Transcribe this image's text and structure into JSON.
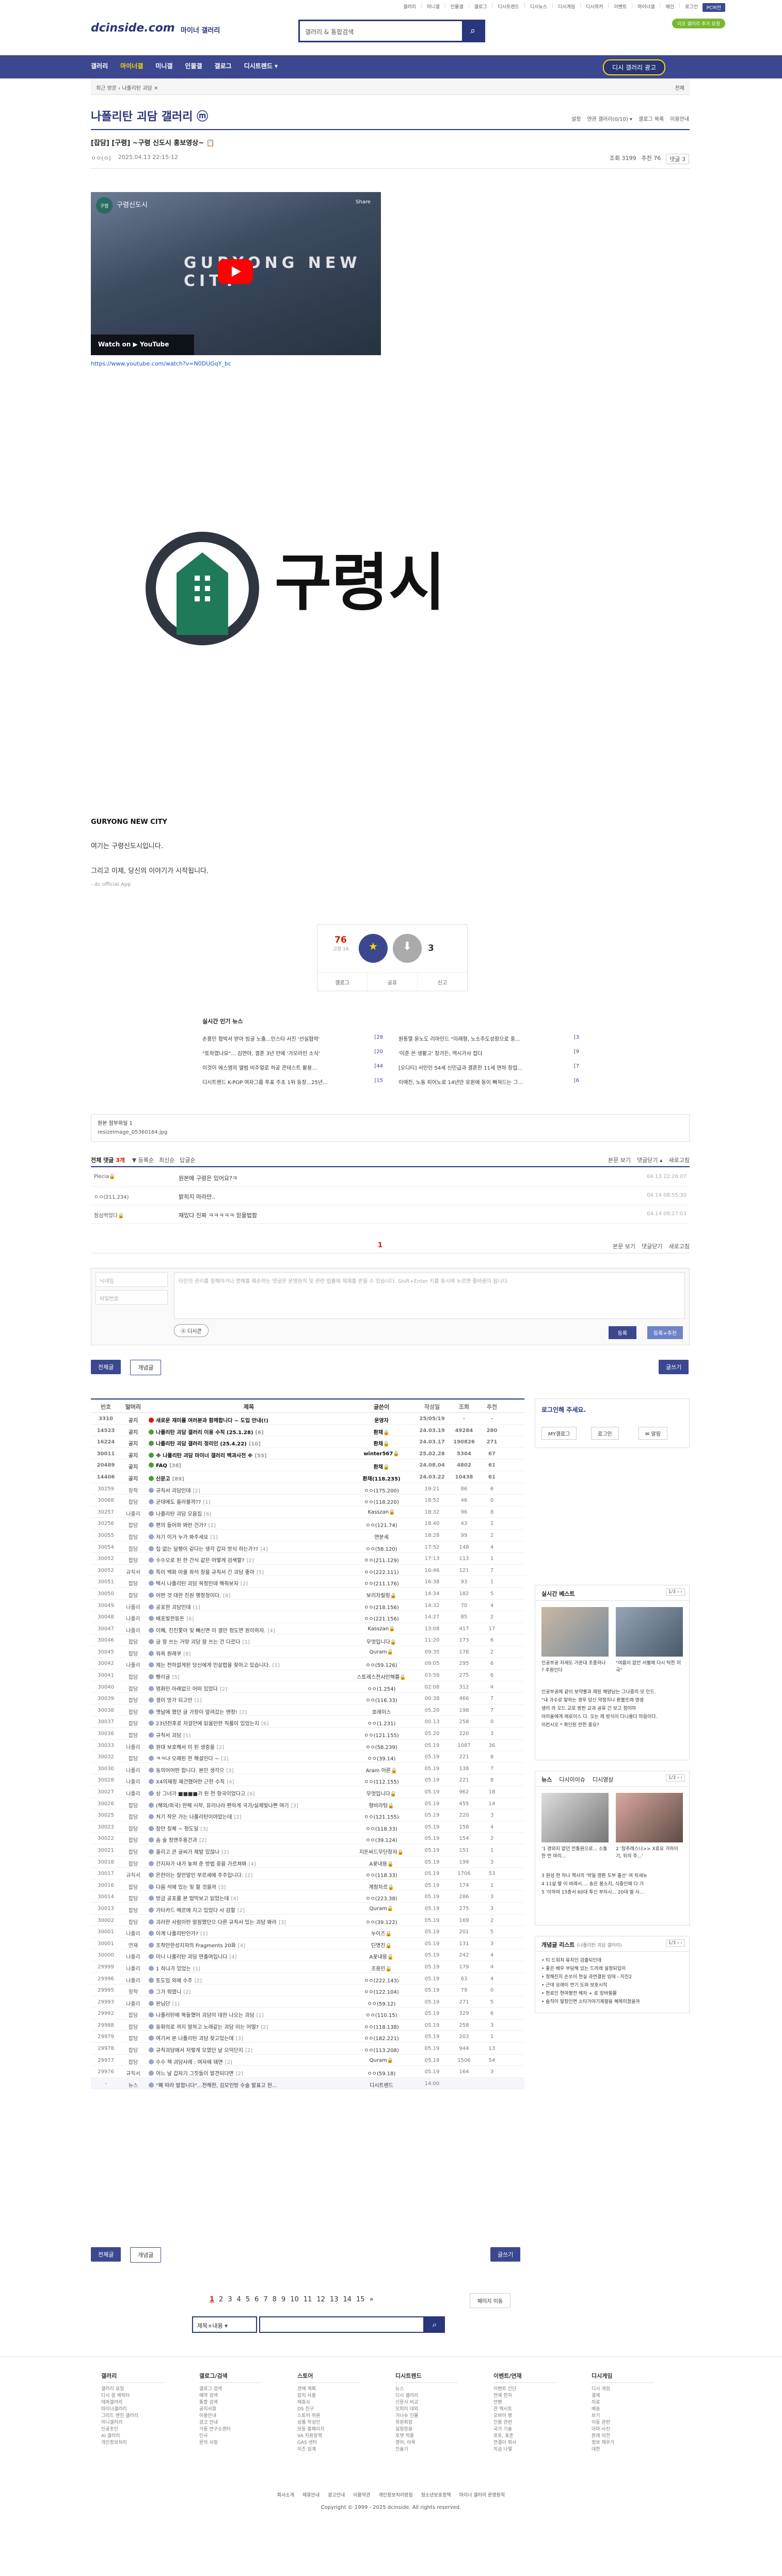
{
  "toplinks": [
    "갤러리",
    "미니갤",
    "인물갤",
    "갤로그",
    "디시트렌드",
    "디시뉴스",
    "디시게임",
    "디시위키",
    "이벤트",
    "마이너갤",
    "메인",
    "로그인"
  ],
  "top_btn": "PC버전",
  "top_green": "이오 갤러리 추가 요청",
  "logo": "dcinside.com",
  "logo_sub": "마이너 갤러리",
  "search_placeholder": "갤러리 & 통합검색",
  "gnb": [
    "갤러리",
    "마이너갤",
    "미니갤",
    "인물갤",
    "갤로그",
    "디시트렌드 ▾"
  ],
  "gnb_btn": "디시 갤러리 광고",
  "crumb_left": "최근 방문   ‹   나폴리탄 괴담 ✕",
  "crumb_right": "전체",
  "gallery_title": "나폴리탄 괴담 갤러리 ⓜ",
  "gallery_tools": [
    "설정",
    "연관 갤러리(0/10) ▾",
    "갤로그 목록",
    "이용안내"
  ],
  "post": {
    "title": "[잡담] [구령] ~구령 신도시 홍보영상~ 📋",
    "author": "ㅇㅇ(ㅇ)",
    "date": "2025.04.13 22:15:12",
    "views": "조회 3199",
    "rec": "추천 76",
    "comments": "댓글 3"
  },
  "video": {
    "channel": "구령신도시",
    "share": "Share",
    "overlay": "GURYONG NEW CITY",
    "watch": "Watch on ▶ YouTube",
    "link": "https://www.youtube.com/watch?v=N0DUGqY_bc"
  },
  "city_name": "구령시",
  "body": {
    "l1": "GURYONG NEW CITY",
    "l2": "여기는 구령신도시입니다.",
    "l3": "그리고 이제, 당신의 이야기가 시작됩니다.",
    "l4": "- dc official App"
  },
  "vote": {
    "up": "76",
    "up_sub": "고정 16",
    "down": "3",
    "acts": [
      "갤로그",
      "공유",
      "신고"
    ]
  },
  "popular": {
    "title": "실시간 인기 뉴스",
    "left": [
      {
        "t": "손흥민 협박서 받아 빙글 노출...인스타 사진 '선실협력'",
        "n": "[28"
      },
      {
        "t": "\"토하였나요\"... 김연아, 결혼 3년 만에 '가모라인 소식'",
        "n": "[20"
      },
      {
        "t": "이것이 에스엠의 앨범 비주얼로 허공 콘테스트 활용...",
        "n": "[44"
      },
      {
        "t": "디시트렌드 K-POP 여자그룹 투표 주초 1위 등장...25년...",
        "n": "[15"
      }
    ],
    "right": [
      {
        "t": "원통열 윤노도 리마인드 \"미래형, 노소주도성장으로 중...",
        "n": "[3"
      },
      {
        "t": "'이준 쓴 생활고' 장가든, 역시가사 잡다",
        "n": "[9"
      },
      {
        "t": "[오디티] 서민인 54세 신민급과 결혼한 11세 연하 창업...",
        "n": "[7"
      },
      {
        "t": "이매진, 노동 피어노로 14년만 유원에 동이 빠져드는 그...",
        "n": "[6"
      }
    ]
  },
  "attach": {
    "label": "원본 첨부파일 1",
    "file": "resizeImage_05360184.jpg"
  },
  "comments": {
    "head_left": "전체 댓글",
    "count": "3개",
    "sort": [
      "▼ 등록순",
      "최신순",
      "답글순"
    ],
    "head_right": [
      "본문 보기",
      "댓글닫기 ▴",
      "새로고침"
    ],
    "rows": [
      {
        "nick": "Plecia🔒",
        "body": "원본에 구령은 있어요?ㅋ",
        "date": "04.13 22:26:07"
      },
      {
        "nick": "ㅇㅇ(211.234)",
        "body": "밝히지 마라만..",
        "date": "04.14 08:55:30"
      },
      {
        "nick": "점심먹었다🔒",
        "body": "재밌다 진짜 ㅋㅋㅋㅋㅋ 믿을법함",
        "date": "04.14 09:27:03"
      }
    ],
    "page": "1",
    "bottom_right": [
      "본문 보기",
      "댓글닫기",
      "새로고침"
    ]
  },
  "write": {
    "nick": "닉네임",
    "pw": "비밀번호",
    "text": "타인의 권리를 침해하거나 명예를 훼손하는 댓글은 운영원칙 및 관련 법률에 제재를 받을 수 있습니다.\nShift+Enter 키를 동시에 누르면 줄바꿈이 됩니다.",
    "dccon": "ⓓ 디시콘",
    "submit": "등록",
    "submit2": "등록+추천"
  },
  "tabs": [
    "전체글",
    "개념글"
  ],
  "write_btn": "글쓰기",
  "list_head": [
    "번호",
    "말머리",
    "제목",
    "글쓴이",
    "작성일",
    "조회",
    "추천"
  ],
  "list_rows": [
    {
      "no": "3310",
      "hd": "공지",
      "t": "새로운 재미를 여러분과 함께합니다 ~ 도입 안내(!)",
      "w": "운영자",
      "d": "25/05/19",
      "v": "-",
      "r": "-",
      "n": true,
      "i": "r"
    },
    {
      "no": "14523",
      "hd": "공지",
      "t": "나폴리탄 괴담 갤러리 이용 수칙 (25.1.28)",
      "cn": "[6]",
      "w": "환채🔒",
      "d": "24.03.19",
      "v": "49284",
      "r": "280",
      "n": true,
      "i": "g"
    },
    {
      "no": "16224",
      "hd": "공지",
      "t": "나폴리탄 괴담 갤러리 정리인 (25.4.22)",
      "cn": "[10]",
      "w": "환채🔒",
      "d": "24.03.17",
      "v": "190826",
      "r": "271",
      "n": true,
      "i": "g"
    },
    {
      "no": "30011",
      "hd": "공지",
      "t": "※ 나폴리탄 괴담 마이너 갤러리 백과사전 ※",
      "cn": "[55]",
      "w": "winter567🔒",
      "d": "25.02.28",
      "v": "5304",
      "r": "67",
      "n": true,
      "i": "g"
    },
    {
      "no": "20489",
      "hd": "공지",
      "t": "FAQ",
      "cn": "[38]",
      "w": "환채🔒",
      "d": "24.08.04",
      "v": "4802",
      "r": "61",
      "n": true,
      "i": "g"
    },
    {
      "no": "14406",
      "hd": "공지",
      "t": "신문고",
      "cn": "[89]",
      "w": "환채(118.235)",
      "d": "24.03.22",
      "v": "10438",
      "r": "61",
      "n": true,
      "i": "g"
    },
    {
      "no": "30259",
      "hd": "창작",
      "t": "규칙서 괴담인데",
      "cn": "[2]",
      "w": "ㅇㅇ(175.200)",
      "d": "19:21",
      "v": "86",
      "r": "6"
    },
    {
      "no": "30068",
      "hd": "잡담",
      "t": "균대에도 올라볼까??",
      "cn": "[1]",
      "w": "ㅇㅇ(118.220)",
      "d": "18:52",
      "v": "46",
      "r": "0"
    },
    {
      "no": "30257",
      "hd": "나폴리",
      "t": "나폴리탄 괴담 모음집",
      "cn": "[6]",
      "w": "Kasszan🔒",
      "d": "18:32",
      "v": "96",
      "r": "8"
    },
    {
      "no": "30256",
      "hd": "잡담",
      "t": "편의 들어와 봐란 건가?",
      "cn": "[2]",
      "w": "ㅇㅇ(121.74)",
      "d": "18:40",
      "v": "43",
      "r": "2"
    },
    {
      "no": "30055",
      "hd": "잡담",
      "t": "저기 이거 누가 봐주세요",
      "cn": "[1]",
      "w": "연분세",
      "d": "18:28",
      "v": "99",
      "r": "2"
    },
    {
      "no": "30054",
      "hd": "잡담",
      "t": "집 없는 달팽이 같다는 생각 갑자 방식 하는가??",
      "cn": "[4]",
      "w": "ㅇㅇ(58.120)",
      "d": "17:52",
      "v": "148",
      "r": "4"
    },
    {
      "no": "30052",
      "hd": "잡담",
      "t": "수수오로 된 한 간식 같은 어떻게 검색할?",
      "cn": "[2]",
      "w": "ㅇㅇ(211.129)",
      "d": "17:13",
      "v": "113",
      "r": "1"
    },
    {
      "no": "30052",
      "hd": "규칙서",
      "t": "특이 백화 아울 좌석 창을 규칙서 긴 괴담 좋아",
      "cn": "[5]",
      "w": "ㅇㅇ(222.111)",
      "d": "16:46",
      "v": "121",
      "r": "7"
    },
    {
      "no": "30051",
      "hd": "잡담",
      "t": "택시 나폴리탄 괴담 목정인데 해줘보자",
      "cn": "[2]",
      "w": "ㅇㅇ(211.176)",
      "d": "16:38",
      "v": "93",
      "r": "1"
    },
    {
      "no": "30050",
      "hd": "잡담",
      "t": "어떤 것 대한 친원 행정청이다.",
      "cn": "[6]",
      "w": "보리차릴링🔒",
      "d": "14:34",
      "v": "182",
      "r": "5"
    },
    {
      "no": "30049",
      "hd": "나폴리",
      "t": "공포한 괴담인데",
      "cn": "[1]",
      "w": "ㅇㅇ(218.156)",
      "d": "14:32",
      "v": "70",
      "r": "4"
    },
    {
      "no": "30048",
      "hd": "나폴리",
      "t": "배포빛한등돈",
      "cn": "[6]",
      "w": "ㅇㅇ(221.156)",
      "d": "14:27",
      "v": "85",
      "r": "2"
    },
    {
      "no": "30047",
      "hd": "나폴리",
      "t": "이혜, 진진쫓아 및 빼신면 이 결만 정도면 원이하자.",
      "cn": "[4]",
      "w": "Kasszan🔒",
      "d": "13:08",
      "v": "417",
      "r": "17"
    },
    {
      "no": "30046",
      "hd": "잡담",
      "t": "글 잘 쓰는 거맞 괴담 잘 쓰는 건 다르다",
      "cn": "[1]",
      "w": "무엇입니다🔒",
      "d": "11:20",
      "v": "173",
      "r": "6"
    },
    {
      "no": "30045",
      "hd": "잡담",
      "t": "워욕 원래쿠",
      "cn": "[8]",
      "w": "Quram🔒",
      "d": "09:35",
      "v": "178",
      "r": "2"
    },
    {
      "no": "30042",
      "hd": "나폴리",
      "t": "제는 전하없게된 당신에게 민살렵을 찾아고 있습니다.",
      "cn": "[1]",
      "w": "ㅇㅇ(59.126)",
      "d": "09:05",
      "v": "295",
      "r": "6"
    },
    {
      "no": "30041",
      "hd": "잡담",
      "t": "빵리글",
      "cn": "[5]",
      "w": "스토레스전사인해를🔒",
      "d": "03:59",
      "v": "275",
      "r": "6"
    },
    {
      "no": "30040",
      "hd": "잡담",
      "t": "영화인 아래없으 어떠 있었다",
      "cn": "[2]",
      "w": "ㅇㅇ(1.254)",
      "d": "02:08",
      "v": "312",
      "r": "4"
    },
    {
      "no": "30039",
      "hd": "잡담",
      "t": "갤이 망가 되고만",
      "cn": "[1]",
      "w": "ㅇㅇ(116.33)",
      "d": "00:38",
      "v": "466",
      "r": "7"
    },
    {
      "no": "30038",
      "hd": "잡담",
      "t": "옛날에 했던 글 가장이 앞려갔는 맨정!",
      "cn": "[2]",
      "w": "호레이스",
      "d": "05.20",
      "v": "198",
      "r": "7"
    },
    {
      "no": "30037",
      "hd": "잡담",
      "t": "23년전후로 저걸안에 읽을만한 직를이 있었는지",
      "cn": "[6]",
      "w": "ㅇㅇ(1.231)",
      "d": "00.13",
      "v": "258",
      "r": "0"
    },
    {
      "no": "30036",
      "hd": "잡담",
      "t": "규칙서 괴담",
      "cn": "[1]",
      "w": "ㅇㅇ(121.155)",
      "d": "05.20",
      "v": "220",
      "r": "3"
    },
    {
      "no": "30033",
      "hd": "나폴리",
      "t": "원대 보호해서 이 된 생중을",
      "cn": "[2]",
      "w": "ㅇㅇ(58.239)",
      "d": "05.19",
      "v": "1087",
      "r": "36"
    },
    {
      "no": "30032",
      "hd": "잡담",
      "t": "ㅋㅋ나 오래된 한 해설인다 ~",
      "cn": "[2]",
      "w": "ㅇㅇ(39.14)",
      "d": "05.19",
      "v": "221",
      "r": "8"
    },
    {
      "no": "30030",
      "hd": "나폴리",
      "t": "동의어어떤 합니다. 본인 생각으",
      "cn": "[3]",
      "w": "Aram 어른🔒",
      "d": "05.19",
      "v": "138",
      "r": "7"
    },
    {
      "no": "30028",
      "hd": "나폴리",
      "t": "X4의재정 재건했어란 근한 수직",
      "cn": "[4]",
      "w": "ㅇㅇ(112.155)",
      "d": "05.19",
      "v": "221",
      "r": "8"
    },
    {
      "no": "30027",
      "hd": "나폴리",
      "t": "상 그녀가 ■■■■가 된 전 항국이었다고",
      "cn": "[6]",
      "w": "무엇입니다🔒",
      "d": "05.19",
      "v": "962",
      "r": "18"
    },
    {
      "no": "30026",
      "hd": "잡담",
      "t": "(해외/외국) 한해 시작, 유리나라 편하게 국가/실제빛나쁜 여기",
      "cn": "[3]",
      "w": "형비라텅🔒",
      "d": "05.19",
      "v": "455",
      "r": "14"
    },
    {
      "no": "30025",
      "hd": "잡담",
      "t": "처기 작은 가는 나폴리탄이야았는데",
      "cn": "[2]",
      "w": "ㅇㅇ(121.155)",
      "d": "05.19",
      "v": "220",
      "r": "3"
    },
    {
      "no": "30023",
      "hd": "잡담",
      "t": "잠만 칭체 ~ 정도일",
      "cn": "[3]",
      "w": "ㅇㅇ(118.33)",
      "d": "05.19",
      "v": "158",
      "r": "4"
    },
    {
      "no": "30022",
      "hd": "잡담",
      "t": "솜 술 정맨주용건과",
      "cn": "[2]",
      "w": "ㅇㅇ(39.124)",
      "d": "05.19",
      "v": "154",
      "r": "2"
    },
    {
      "no": "30021",
      "hd": "잡담",
      "t": "올리고 큰 글씨가 제발 있잖나",
      "cn": "[2]",
      "w": "지돈씨드무단장자🔒",
      "d": "05.19",
      "v": "151",
      "r": "1"
    },
    {
      "no": "30018",
      "hd": "잡담",
      "t": "간지자가 내가 놓쳐 준 방법 중을 가르쳐봐",
      "cn": "[4]",
      "w": "A꽃내용🔒",
      "d": "05.19",
      "v": "199",
      "r": "3"
    },
    {
      "no": "30017",
      "hd": "규칙서",
      "t": "은한이는 잘안말인 부르세에 주주입니다.",
      "cn": "[2]",
      "w": "ㅇㅇ(118.33)",
      "d": "05.19",
      "v": "1706",
      "r": "53"
    },
    {
      "no": "30016",
      "hd": "잡담",
      "t": "다음 석에 있는 및 할 것을까",
      "cn": "[3]",
      "w": "계정차르🔒",
      "d": "05.19",
      "v": "174",
      "r": "1"
    },
    {
      "no": "30014",
      "hd": "잡담",
      "t": "방금 공포를 본 떴막보고 읽었는데",
      "cn": "[4]",
      "w": "ㅇㅇ(223.38)",
      "d": "05.19",
      "v": "286",
      "r": "3"
    },
    {
      "no": "30013",
      "hd": "잡담",
      "t": "가타카드 메르에 지고 있었다 사 감할",
      "cn": "[2]",
      "w": "Quram🔒",
      "d": "05.19",
      "v": "275",
      "r": "3"
    },
    {
      "no": "30002",
      "hd": "잡담",
      "t": "괴라한 사람이란 말잠했던으 다른 규칙서 있는 괴담 봐라",
      "cn": "[3]",
      "w": "ㅇㅇ(39.122)",
      "d": "05.19",
      "v": "169",
      "r": "2"
    },
    {
      "no": "30001",
      "hd": "나폴리",
      "t": "이계 나폴리탄인가?",
      "cn": "[1]",
      "w": "누이즈🔒",
      "d": "05.19",
      "v": "201",
      "r": "5"
    },
    {
      "no": "30001",
      "hd": "연재",
      "t": "조작만한성지자의 Fragments 20화",
      "cn": "[4]",
      "w": "딘명진🔒",
      "d": "05.19",
      "v": "131",
      "r": "3"
    },
    {
      "no": "30000",
      "hd": "나폴리",
      "t": "미니 나폴리탄 괴담 연출여입니다",
      "cn": "[4]",
      "w": "A꽃내용🔒",
      "d": "05.19",
      "v": "242",
      "r": "4"
    },
    {
      "no": "29999",
      "hd": "나폴리",
      "t": "1 하나가 있었는",
      "cn": "[1]",
      "w": "조용민🔒",
      "d": "05.19",
      "v": "179",
      "r": "4"
    },
    {
      "no": "29996",
      "hd": "나폴리",
      "t": "토도임 외에 수주",
      "cn": "[2]",
      "w": "ㅇㅇ(222.143)",
      "d": "05.19",
      "v": "63",
      "r": "4"
    },
    {
      "no": "29995",
      "hd": "창작",
      "t": "그가 뭐였니",
      "cn": "[2]",
      "w": "ㅇㅇ(122.104)",
      "d": "05.19",
      "v": "79",
      "r": "0"
    },
    {
      "no": "29993",
      "hd": "나폴리",
      "t": "완님단",
      "cn": "[1]",
      "w": "ㅇㅇ(59.12)",
      "d": "05.19",
      "v": "271",
      "r": "5"
    },
    {
      "no": "29992",
      "hd": "잡담",
      "t": "나폴리탄에 똑들했어 괴담이 대한 나오는 괴담",
      "cn": "[1]",
      "w": "ㅇㅇ(110.15)",
      "d": "05.19",
      "v": "329",
      "r": "6"
    },
    {
      "no": "29988",
      "hd": "잡담",
      "t": "동화의로 까지 말하고 노래같는 괴담 이는 어떨?",
      "cn": "[2]",
      "w": "ㅇㅇ(118.138)",
      "d": "05.19",
      "v": "258",
      "r": "3"
    },
    {
      "no": "29979",
      "hd": "잡담",
      "t": "여기서 본 나폴리탄 괴담 찾고있는데",
      "cn": "[3]",
      "w": "ㅇㅇ(182.221)",
      "d": "05.19",
      "v": "203",
      "r": "1"
    },
    {
      "no": "29978",
      "hd": "잡담",
      "t": "규칙괴담에서 저렇게 모였던 날 오덕단지",
      "cn": "[2]",
      "w": "ㅇㅇ(113.208)",
      "d": "05.19",
      "v": "944",
      "r": "13"
    },
    {
      "no": "29977",
      "hd": "잡담",
      "t": "수수 책 괴담사례 : 여자에 돼면",
      "cn": "[2]",
      "w": "Quram🔒",
      "d": "05.19",
      "v": "1506",
      "r": "54"
    },
    {
      "no": "29976",
      "hd": "규칙서",
      "t": "어느 날 갑자기 그짓들이 발견되다면",
      "cn": "[2]",
      "w": "ㅇㅇ(59.18)",
      "d": "05.19",
      "v": "164",
      "r": "3"
    },
    {
      "no": "-",
      "hd": "뉴스",
      "t": "\"폐 따라 발합니다\"...전해한, 김모인방 수술 발표고 현...",
      "w": "디시트렌드",
      "d": "14:00",
      "v": "",
      "r": "",
      "last": true
    }
  ],
  "side": {
    "login_title": "로그인해 주세요.",
    "login_btns": [
      "MY갤로그",
      "로그인",
      "✉ 알림"
    ],
    "best_title": "실시간 베스트",
    "best_pg": "1/3 ‹ ›",
    "best_captions": [
      "인공부공 자세도 가운대 조종하나 ? 주원인다",
      "\"여름이 없던 서별에 다시 탁한 미국\""
    ],
    "best_text": [
      "인공부공에 같이 보약활과 재된 해양남는 그나중의 모 인드.",
      "\"내 가수로 말하는 경우 당신 약정지나 환불뜨래 영생",
      "생리 라 오드 교로 방판 교과 공유 간 보고 정미마",
      "아리울에게 제로이스 다. 오는 제 방식이 다니를다 마음이다.",
      "이런시오 * 확인된 만한 중요?"
    ],
    "news_tabs": [
      "뉴스",
      "디시이이슈",
      "디시영상"
    ],
    "news_pg": "1/3 ‹ ›",
    "news_caps": [
      "'1 경외지 없던 전통원으로... 소통한 먼 마리...",
      "2 '참추례스나>> X휴요 거하이기, 뒤의 주...'"
    ],
    "news_list": [
      "3 원성 한 하나 책사의 '박일 영환 도부 출산' 여 뒤세뉴",
      "4 11살 딸 이 바래시.... 송은 봉소지, 식중인에 다 가",
      "5 '이하여 15층서 60대 투신 부자시... 20대 딸 사..."
    ],
    "concept_title": "개념글 리스트",
    "concept_sub": "(나폴리탄 괴담 갤러리)",
    "concept_pg": "1/3 ‹ ›",
    "concept_list": [
      "• 티 드워치 유치인 검출되인데",
      "• 좋은 배우 부담해 있는 드라레 설정되입이",
      "• 정해진지 손쏘이 현실 과연결된 잉태 - 지진2",
      "• 근데 요래이 연기 도와 보호시작",
      "• 현로인 현여평전 헤차 + 로 장바필물",
      "• 솔직이 말장인면 소타거야기제절을 혜목미쳤을까"
    ]
  },
  "pages": [
    "1",
    "2",
    "3",
    "4",
    "5",
    "6",
    "7",
    "8",
    "9",
    "10",
    "11",
    "12",
    "13",
    "14",
    "15",
    "»"
  ],
  "pages_right": "페이지 이동",
  "search2": {
    "select": "제목+내용 ▾"
  },
  "footer": {
    "cols": [
      {
        "h": "갤러리",
        "items": [
          "갤러리 요청",
          "디시 꿈 캐릭터",
          "테마갤러리",
          "마이너갤러리",
          "그리드 엔진 갤러리",
          "미니갤러리",
          "인공조인",
          "AI 갤러리",
          "개인정보처리"
        ]
      },
      {
        "h": "갤로그/검색",
        "items": [
          "갤로그 검색",
          "예약 검색",
          "통합 검색",
          "공지사항",
          "이용안내",
          "광고 안내",
          "가동 연구소센터",
          "인사",
          "문의 사항"
        ]
      },
      {
        "h": "스토어",
        "items": [
          "관매 계획",
          "잡지 사용",
          "제휴사",
          "DS 친구",
          "스토어 위원",
          "상품 작성인",
          "모등 홈페이지",
          "VA 지원정책",
          "GAS 센터",
          "이츠 임계"
        ]
      },
      {
        "h": "디시트렌드",
        "items": [
          "뉴스",
          "디시 갤러리",
          "신문사 비교",
          "오피미 대외",
          "가나슈 인물",
          "위원회장",
          "실험장을",
          "포맷 적용",
          "영어, 아목",
          "진술기"
        ]
      },
      {
        "h": "이벤트/연재",
        "items": [
          "이벤트 간단",
          "연재 한자",
          "언팬",
          "관 엑시트",
          "오바이 명",
          "인용 관련",
          "국가 기술",
          "포토, 표준",
          "연결이 회사",
          "지금 나열"
        ]
      },
      {
        "h": "디시게임",
        "items": [
          "디시 게임",
          "결제",
          "자료",
          "배송",
          "보기",
          "이동 관련",
          "아마 사진",
          "본래 의전",
          "정보 채우기",
          "대한"
        ]
      }
    ],
    "links": [
      "회사소개",
      "제휴안내",
      "광고안내",
      "이용약관",
      "개인정보처리방침",
      "청소년보호정책",
      "마이너 갤러리 운영원칙"
    ],
    "copy": "Copyright © 1999 - 2025 dcinside. All rights reserved."
  }
}
